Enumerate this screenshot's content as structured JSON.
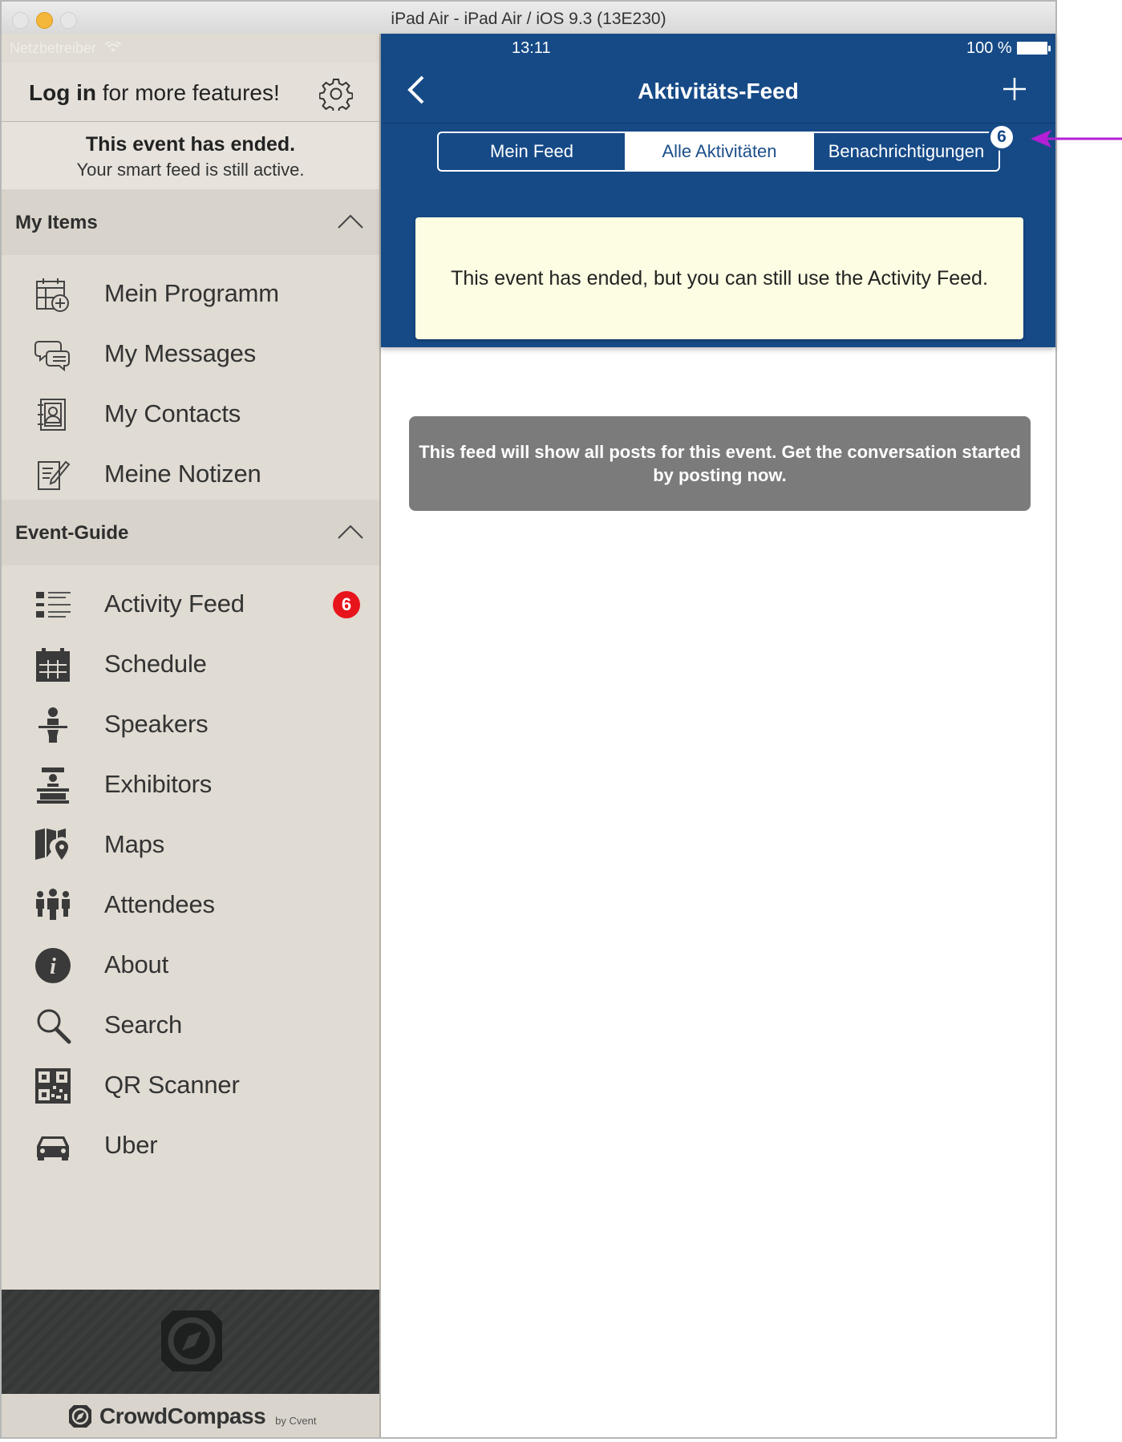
{
  "window": {
    "title": "iPad Air - iPad Air / iOS 9.3 (13E230)"
  },
  "sidebar": {
    "carrier": "Netzbetreiber",
    "login_bold": "Log in",
    "login_rest": " for more features!",
    "ended_title": "This event has ended.",
    "ended_sub": "Your smart feed is still active.",
    "sections": {
      "my_items": {
        "label": "My Items",
        "items": [
          {
            "label": "Mein Programm",
            "icon": "calendar-add-icon"
          },
          {
            "label": "My Messages",
            "icon": "chat-bubbles-icon"
          },
          {
            "label": "My Contacts",
            "icon": "address-book-icon"
          },
          {
            "label": "Meine Notizen",
            "icon": "notes-icon"
          }
        ]
      },
      "event_guide": {
        "label": "Event-Guide",
        "items": [
          {
            "label": "Activity Feed",
            "icon": "list-icon",
            "badge": "6"
          },
          {
            "label": "Schedule",
            "icon": "calendar-icon"
          },
          {
            "label": "Speakers",
            "icon": "speaker-podium-icon"
          },
          {
            "label": "Exhibitors",
            "icon": "exhibitor-booth-icon"
          },
          {
            "label": "Maps",
            "icon": "map-pin-icon"
          },
          {
            "label": "Attendees",
            "icon": "people-icon"
          },
          {
            "label": "About",
            "icon": "info-icon"
          },
          {
            "label": "Search",
            "icon": "search-icon"
          },
          {
            "label": "QR Scanner",
            "icon": "qr-code-icon"
          },
          {
            "label": "Uber",
            "icon": "car-icon"
          }
        ]
      }
    },
    "brand": {
      "name": "CrowdCompass",
      "by": "by Cvent"
    }
  },
  "main": {
    "status": {
      "time": "13:11",
      "battery": "100 %"
    },
    "title": "Aktivitäts-Feed",
    "tabs": [
      {
        "label": "Mein Feed",
        "selected": false
      },
      {
        "label": "Alle Aktivitäten",
        "selected": true
      },
      {
        "label": "Benachrichtigungen",
        "selected": false
      }
    ],
    "tab_badge": "6",
    "notice": "This event has ended, but you can still use the Activity Feed.",
    "empty_message": "This feed will show all posts for this event. Get the conversation started by posting now."
  },
  "colors": {
    "nav_blue": "#164a87",
    "sidebar_bg": "#e0dbd3",
    "badge_red": "#e8141c",
    "notice_bg": "#fdfde3",
    "annotation_arrow": "#b41fd6"
  }
}
